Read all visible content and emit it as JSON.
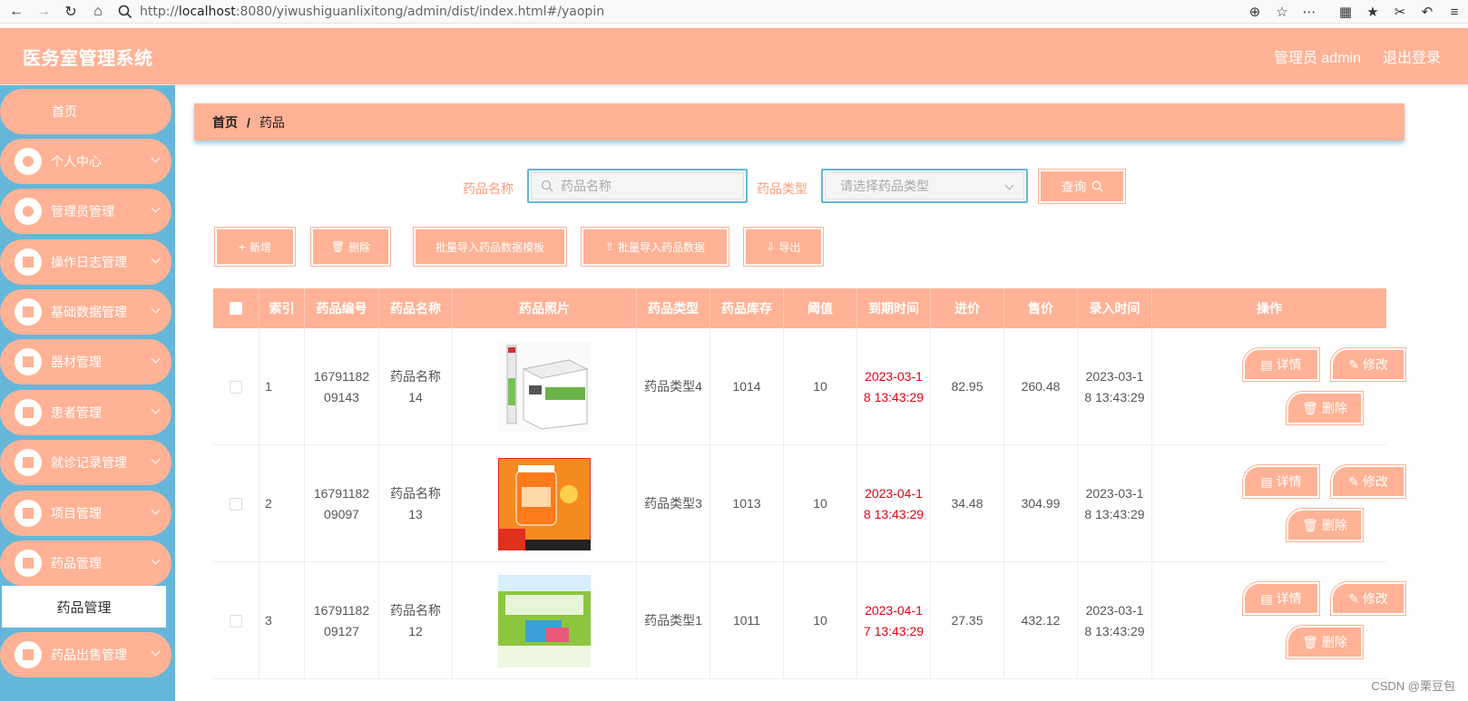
{
  "browser": {
    "url_prefix": "http://",
    "url_host": "localhost",
    "url_rest": ":8080/yiwushiguanlixitong/admin/dist/index.html#/yaopin"
  },
  "header": {
    "title": "医务室管理系统",
    "user": "管理员 admin",
    "logout": "退出登录"
  },
  "sidebar": {
    "items": [
      {
        "label": "首页"
      },
      {
        "label": "个人中心"
      },
      {
        "label": "管理员管理"
      },
      {
        "label": "操作日志管理"
      },
      {
        "label": "基础数据管理"
      },
      {
        "label": "器材管理"
      },
      {
        "label": "患者管理"
      },
      {
        "label": "就诊记录管理"
      },
      {
        "label": "项目管理"
      },
      {
        "label": "药品管理"
      },
      {
        "label": "药品出售管理"
      }
    ],
    "active_sub": "药品管理"
  },
  "breadcrumb": {
    "home": "首页",
    "sep": "/",
    "current": "药品"
  },
  "search": {
    "name_label": "药品名称",
    "name_placeholder": "药品名称",
    "type_label": "药品类型",
    "type_placeholder": "请选择药品类型",
    "query_label": "查询"
  },
  "actions": {
    "add": "新增",
    "delete": "删除",
    "template": "批量导入药品数据模板",
    "import": "批量导入药品数据",
    "export": "导出"
  },
  "table": {
    "headers": [
      "索引",
      "药品编号",
      "药品名称",
      "药品照片",
      "药品类型",
      "药品库存",
      "阈值",
      "到期时间",
      "进价",
      "售价",
      "录入时间",
      "操作"
    ],
    "rows": [
      {
        "index": "1",
        "code": "1679118209143",
        "name": "药品名称14",
        "type": "药品类型4",
        "stock": "1014",
        "threshold": "10",
        "expire": "2023-03-18 13:43:29",
        "cost": "82.95",
        "price": "260.48",
        "created": "2023-03-18 13:43:29"
      },
      {
        "index": "2",
        "code": "1679118209097",
        "name": "药品名称13",
        "type": "药品类型3",
        "stock": "1013",
        "threshold": "10",
        "expire": "2023-04-18 13:43:29",
        "cost": "34.48",
        "price": "304.99",
        "created": "2023-03-18 13:43:29"
      },
      {
        "index": "3",
        "code": "1679118209127",
        "name": "药品名称12",
        "type": "药品类型1",
        "stock": "1011",
        "threshold": "10",
        "expire": "2023-04-17 13:43:29",
        "cost": "27.35",
        "price": "432.12",
        "created": "2023-03-18 13:43:29"
      }
    ],
    "op_detail": "详情",
    "op_edit": "修改",
    "op_delete": "删除"
  },
  "watermark": "CSDN @栗豆包",
  "colors": {
    "primary": "#ffb295",
    "sidebar": "#65b7d9",
    "expire": "#e60012"
  }
}
